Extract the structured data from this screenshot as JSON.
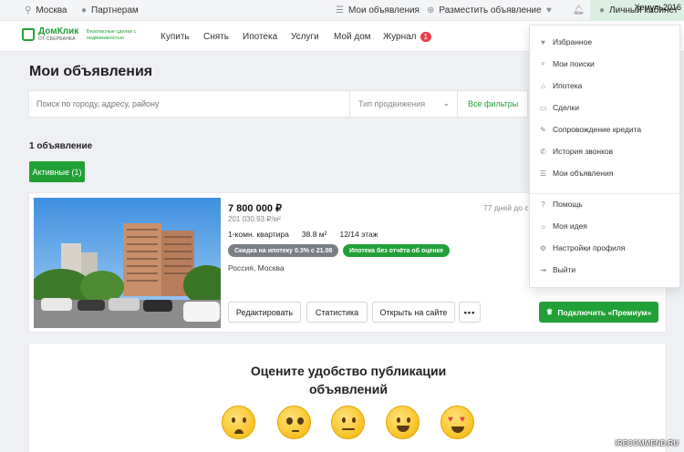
{
  "topbar": {
    "city": "Москва",
    "partners": "Партнерам",
    "my_ads": "Мои объявления",
    "post_ad": "Разместить объявление",
    "cabinet": "Личный кабинет"
  },
  "header": {
    "logo_name": "ДомКлик",
    "logo_sub": "ОТ СБЕРБАНКА",
    "logo_tagline": "Безопасные сделки с недвижимостью",
    "nav": [
      {
        "label": "Купить"
      },
      {
        "label": "Снять"
      },
      {
        "label": "Ипотека"
      },
      {
        "label": "Услуги"
      },
      {
        "label": "Мой дом"
      },
      {
        "label": "Журнал",
        "badge": "1"
      }
    ]
  },
  "page": {
    "title": "Мои объявления",
    "search_placeholder": "Поиск по городу, адресу, району",
    "promo_select": "Тип продвижения",
    "all_filters": "Все фильтры",
    "count": "1 объявление",
    "active_tab": "Активные (1)"
  },
  "listing": {
    "price": "7 800 000 ₽",
    "price_per_m": "201 030.93 ₽/м²",
    "days": "77 дней до сн",
    "rooms": "1-комн. квартира",
    "area": "38.8 м²",
    "floor": "12/14 этаж",
    "tag_discount": "Скидка на ипотеку 0.3% с 21.08",
    "tag_mortgage": "Ипотека без отчёта об оценке",
    "location": "Россия, Москва",
    "btn_edit": "Редактировать",
    "btn_stats": "Статистика",
    "btn_open": "Открыть на сайте",
    "btn_more": "•••",
    "btn_premium": "Подключить «Премиум»"
  },
  "rating": {
    "title_line1": "Оцените удобство публикации",
    "title_line2": "объявлений",
    "emojis": [
      "crying-face-icon",
      "pleading-face-icon",
      "neutral-face-icon",
      "smiling-face-icon",
      "heart-eyes-face-icon"
    ]
  },
  "dropdown": {
    "items": [
      {
        "label": "Избранное",
        "icon": "heart-icon"
      },
      {
        "label": "Мои поиски",
        "icon": "search-icon"
      },
      {
        "label": "Ипотека",
        "icon": "home-icon"
      },
      {
        "label": "Сделки",
        "icon": "document-icon"
      },
      {
        "label": "Сопровождение кредита",
        "icon": "pencil-icon"
      },
      {
        "label": "История звонков",
        "icon": "phone-icon"
      },
      {
        "label": "Мои объявления",
        "icon": "list-icon"
      },
      {
        "label": "Помощь",
        "icon": "help-icon"
      },
      {
        "label": "Моя идея",
        "icon": "lightbulb-icon"
      },
      {
        "label": "Настройки профиля",
        "icon": "gear-icon"
      },
      {
        "label": "Выйти",
        "icon": "logout-icon"
      }
    ]
  },
  "watermarks": {
    "user": "Хемуль2016",
    "site": "IRECOMMEND.RU"
  },
  "colors": {
    "accent": "#21a038",
    "badge": "#e8414b"
  }
}
